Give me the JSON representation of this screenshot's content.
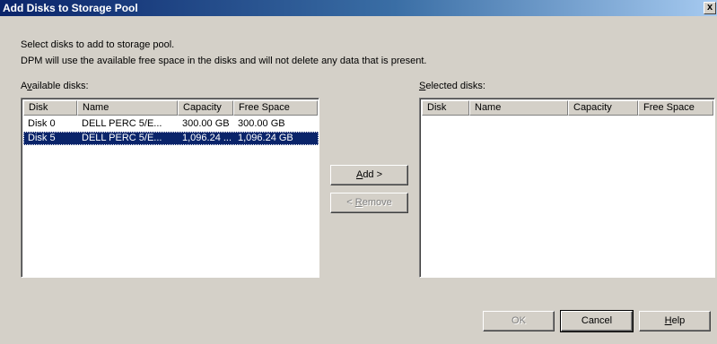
{
  "window": {
    "title": "Add Disks to Storage Pool",
    "close_glyph": "x"
  },
  "intro": {
    "line1": "Select disks to add to storage pool.",
    "line2": "DPM will use the available free space in the disks and will not delete any data that is present."
  },
  "available": {
    "label_prefix": "A",
    "label_mnemonic": "v",
    "label_rest": "ailable disks:",
    "columns": [
      "Disk",
      "Name",
      "Capacity",
      "Free Space"
    ],
    "rows": [
      {
        "disk": "Disk 0",
        "name": "DELL PERC 5/E...",
        "capacity": "300.00 GB",
        "free": "300.00 GB",
        "selected": false
      },
      {
        "disk": "Disk 5",
        "name": "DELL PERC 5/E...",
        "capacity": "1,096.24 ...",
        "free": "1,096.24 GB",
        "selected": true
      }
    ]
  },
  "selected": {
    "label_mnemonic": "S",
    "label_rest": "elected disks:",
    "columns": [
      "Disk",
      "Name",
      "Capacity",
      "Free Space"
    ]
  },
  "buttons": {
    "add": {
      "mnemonic": "A",
      "rest": "dd >"
    },
    "remove": {
      "prefix": "< ",
      "mnemonic": "R",
      "rest": "emove"
    },
    "ok": "OK",
    "cancel": "Cancel",
    "help": {
      "mnemonic": "H",
      "rest": "elp"
    }
  }
}
